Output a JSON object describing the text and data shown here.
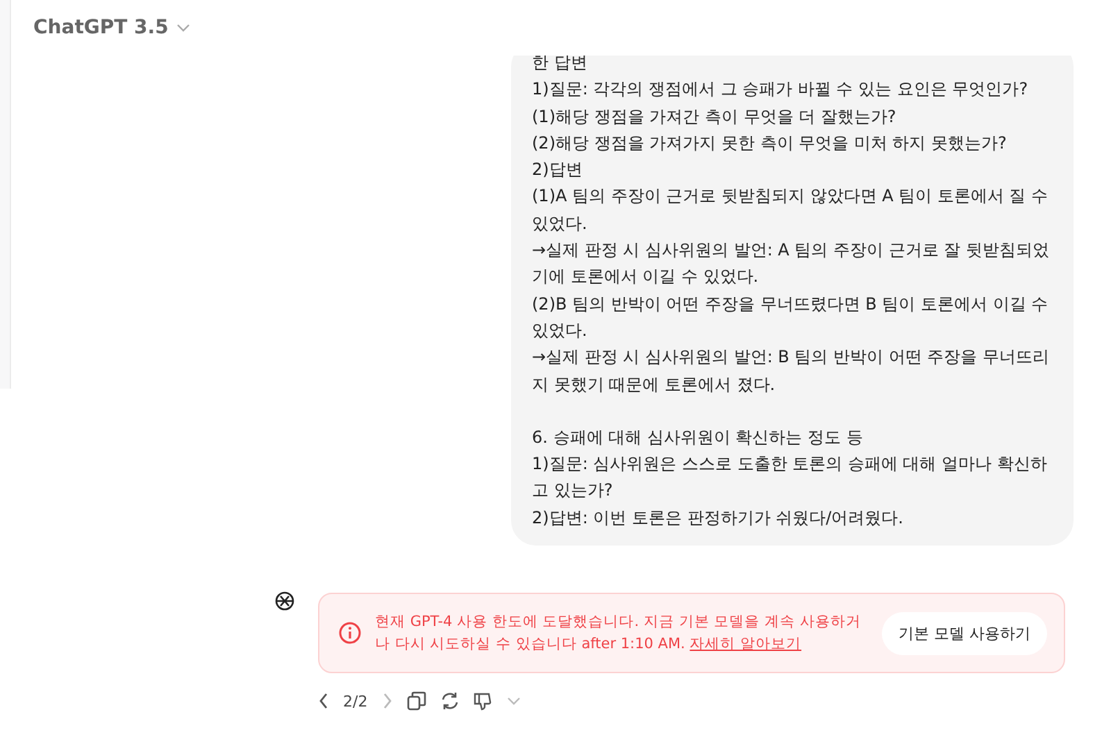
{
  "header": {
    "title": "ChatGPT 3.5"
  },
  "user_message": {
    "paragraphs": [
      [
        "한 답변",
        "1)질문: 각각의 쟁점에서 그 승패가 바뀔 수 있는 요인은 무엇인가?",
        "(1)해당 쟁점을 가져간 측이 무엇을 더 잘했는가?",
        "(2)해당 쟁점을 가져가지 못한 측이 무엇을 미처 하지 못했는가?",
        "2)답변",
        "(1)A 팀의 주장이 근거로 뒷받침되지 않았다면 A 팀이 토론에서 질 수 있었다.",
        "→실제 판정 시 심사위원의 발언: A 팀의 주장이 근거로 잘 뒷받침되었기에 토론에서 이길 수 있었다.",
        "(2)B 팀의 반박이 어떤 주장을 무너뜨렸다면 B 팀이 토론에서 이길 수 있었다.",
        "→실제 판정 시 심사위원의 발언: B 팀의 반박이 어떤 주장을 무너뜨리지 못했기 때문에 토론에서 졌다."
      ],
      [
        "6. 승패에 대해 심사위원이 확신하는 정도 등",
        "1)질문: 심사위원은 스스로 도출한 토론의 승패에 대해 얼마나 확신하고 있는가?",
        "2)답변: 이번 토론은 판정하기가 쉬웠다/어려웠다."
      ]
    ]
  },
  "error": {
    "message": "현재 GPT-4 사용 한도에 도달했습니다. 지금 기본 모델을 계속 사용하거나 다시 시도하실 수 있습니다 after 1:10 AM. ",
    "link": "자세히 알아보기",
    "button": "기본 모델 사용하기"
  },
  "pager": {
    "text": "2/2"
  }
}
